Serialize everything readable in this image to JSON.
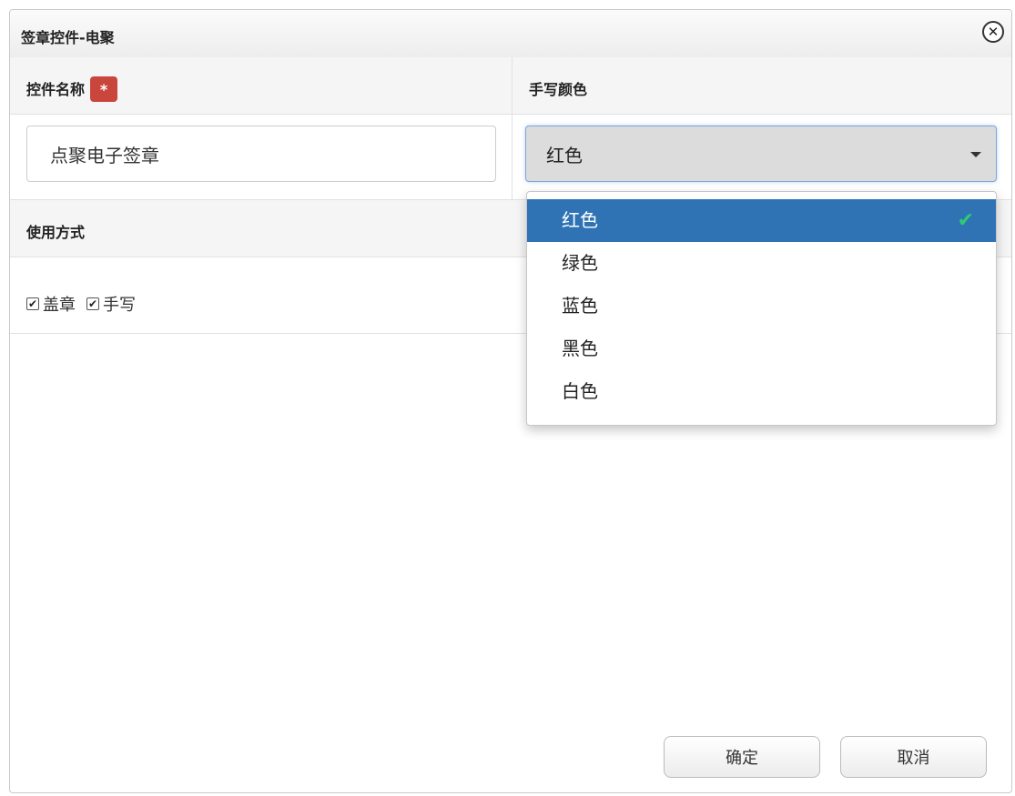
{
  "dialog": {
    "title": "签章控件-电聚",
    "close_icon": "close-circle-icon"
  },
  "form": {
    "control_name_label": "控件名称",
    "required_mark": "*",
    "control_name_value": "点聚电子签章",
    "handwriting_color_label": "手写颜色",
    "handwriting_color_value": "红色",
    "usage_label": "使用方式",
    "usage_options": [
      {
        "label": "盖章",
        "checked": true
      },
      {
        "label": "手写",
        "checked": true
      }
    ]
  },
  "color_dropdown": {
    "options": [
      {
        "label": "红色",
        "selected": true
      },
      {
        "label": "绿色",
        "selected": false
      },
      {
        "label": "蓝色",
        "selected": false
      },
      {
        "label": "黑色",
        "selected": false
      },
      {
        "label": "白色",
        "selected": false
      }
    ],
    "selected_check_icon": "checkmark-icon"
  },
  "buttons": {
    "ok": "确定",
    "cancel": "取消"
  },
  "colors": {
    "selected_option_bg": "#2f73b5",
    "required_badge": "#c9463d",
    "checkmark": "#2ecc71"
  }
}
